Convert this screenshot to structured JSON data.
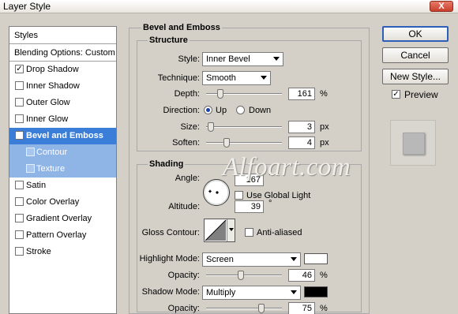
{
  "window": {
    "title": "Layer Style",
    "close_label": "X"
  },
  "sidebar": {
    "styles_label": "Styles",
    "blending_label": "Blending Options: Custom",
    "items": [
      {
        "label": "Drop Shadow",
        "checked": "✓"
      },
      {
        "label": "Inner Shadow",
        "checked": ""
      },
      {
        "label": "Outer Glow",
        "checked": ""
      },
      {
        "label": "Inner Glow",
        "checked": ""
      },
      {
        "label": "Bevel and Emboss",
        "checked": "✓"
      },
      {
        "label": "Contour",
        "checked": ""
      },
      {
        "label": "Texture",
        "checked": ""
      },
      {
        "label": "Satin",
        "checked": ""
      },
      {
        "label": "Color Overlay",
        "checked": ""
      },
      {
        "label": "Gradient Overlay",
        "checked": ""
      },
      {
        "label": "Pattern Overlay",
        "checked": ""
      },
      {
        "label": "Stroke",
        "checked": ""
      }
    ]
  },
  "bevel": {
    "section_title": "Bevel and Emboss",
    "structure": {
      "title": "Structure",
      "style_label": "Style:",
      "style_value": "Inner Bevel",
      "technique_label": "Technique:",
      "technique_value": "Smooth",
      "depth_label": "Depth:",
      "depth_value": "161",
      "depth_unit": "%",
      "depth_level": 0.16,
      "direction_label": "Direction:",
      "up_label": "Up",
      "down_label": "Down",
      "direction_value": "Up",
      "size_label": "Size:",
      "size_value": "3",
      "size_unit": "px",
      "size_level": 0.02,
      "soften_label": "Soften:",
      "soften_value": "4",
      "soften_unit": "px",
      "soften_level": 0.25
    },
    "shading": {
      "title": "Shading",
      "angle_label": "Angle:",
      "angle_value": "167",
      "angle_unit": "°",
      "global_light_label": "Use Global Light",
      "global_light_checked": false,
      "altitude_label": "Altitude:",
      "altitude_value": "39",
      "altitude_unit": "°",
      "gloss_label": "Gloss Contour:",
      "antialiased_label": "Anti-aliased",
      "antialiased_checked": false,
      "highlight_label": "Highlight Mode:",
      "highlight_value": "Screen",
      "highlight_color": "#ffffff",
      "hl_opacity_label": "Opacity:",
      "hl_opacity_value": "46",
      "hl_opacity_unit": "%",
      "hl_opacity_level": 0.46,
      "shadow_label": "Shadow Mode:",
      "shadow_value": "Multiply",
      "shadow_color": "#000000",
      "sh_opacity_label": "Opacity:",
      "sh_opacity_value": "75",
      "sh_opacity_unit": "%",
      "sh_opacity_level": 0.75
    }
  },
  "buttons": {
    "ok": "OK",
    "cancel": "Cancel",
    "new_style": "New Style...",
    "preview_label": "Preview",
    "preview_checked": "✓"
  },
  "watermark": "Alfoart.com",
  "colors": {
    "selection": "#3a7ed8",
    "sub_selection": "#8fb4e6",
    "ok_border": "#2e5fb8"
  }
}
